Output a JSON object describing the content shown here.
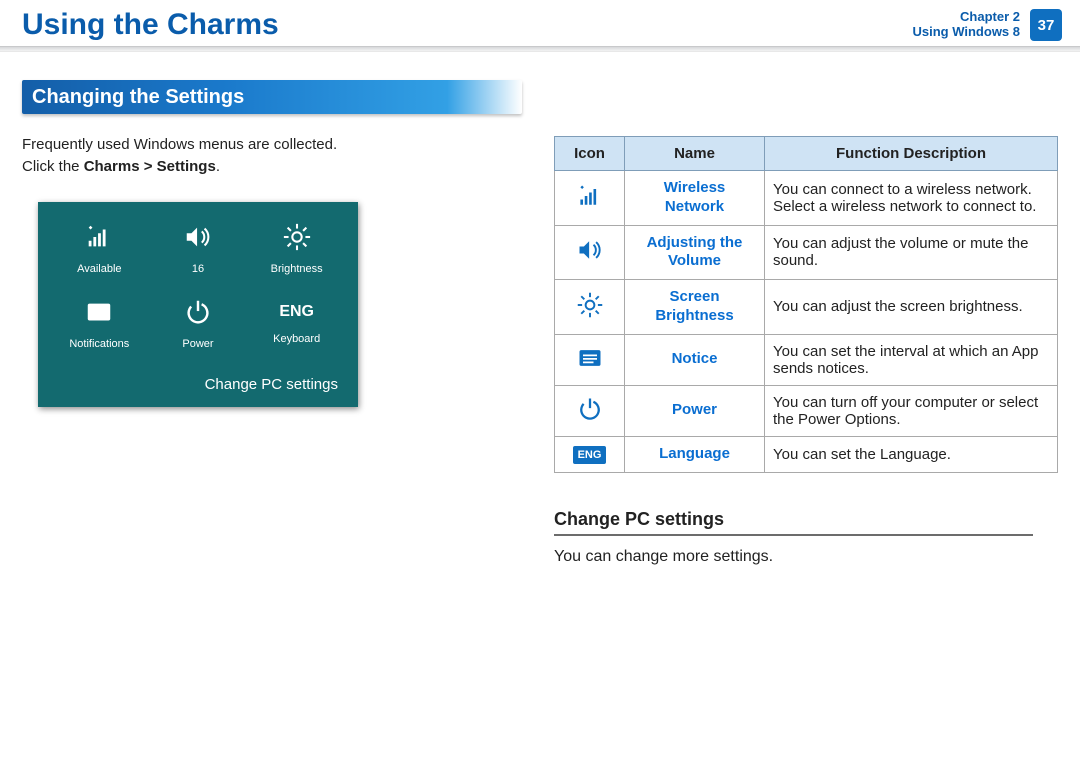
{
  "header": {
    "title": "Using the Charms",
    "chapter_line1": "Chapter 2",
    "chapter_line2": "Using Windows 8",
    "page_number": "37"
  },
  "section_heading": "Changing the Settings",
  "intro": {
    "line1": "Frequently used Windows menus are collected.",
    "line2_prefix": "Click the ",
    "line2_bold": "Charms > Settings",
    "line2_suffix": "."
  },
  "charms_panel": {
    "tiles": [
      {
        "label": "Available",
        "iconName": "wifi-icon"
      },
      {
        "label": "16",
        "iconName": "volume-icon"
      },
      {
        "label": "Brightness",
        "iconName": "brightness-icon"
      },
      {
        "label": "Notifications",
        "iconName": "notifications-icon"
      },
      {
        "label": "Power",
        "iconName": "power-icon"
      },
      {
        "label": "Keyboard",
        "iconName": "keyboard-eng-icon",
        "badge": "ENG"
      }
    ],
    "footer_link": "Change PC settings"
  },
  "table": {
    "headers": {
      "icon": "Icon",
      "name": "Name",
      "desc": "Function Description"
    },
    "rows": [
      {
        "iconName": "wifi-icon",
        "name": "Wireless Network",
        "desc": "You can connect to a wireless network. Select a wireless network to connect to."
      },
      {
        "iconName": "volume-icon",
        "name": "Adjusting the Volume",
        "desc": "You can adjust the volume or mute the sound."
      },
      {
        "iconName": "brightness-icon",
        "name": "Screen Brightness",
        "desc": "You can adjust the screen brightness."
      },
      {
        "iconName": "notifications-icon",
        "name": "Notice",
        "desc": "You can set the interval at which an App sends notices."
      },
      {
        "iconName": "power-icon",
        "name": "Power",
        "desc": "You can turn off your computer or select the Power Options."
      },
      {
        "iconName": "keyboard-eng-icon",
        "name": "Language",
        "desc": "You can set the Language.",
        "badge": "ENG"
      }
    ]
  },
  "subsection": {
    "heading": "Change PC settings",
    "body": "You can change more settings."
  },
  "eng_badge_text": "ENG"
}
